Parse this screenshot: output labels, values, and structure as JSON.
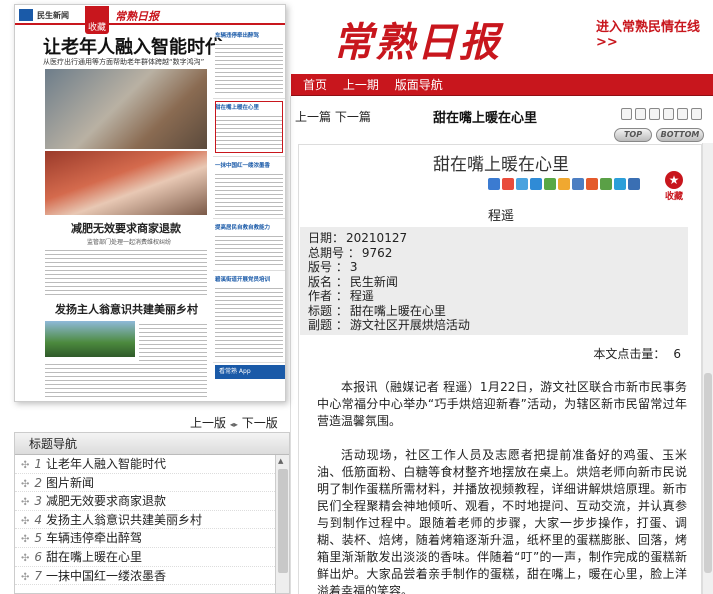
{
  "header": {
    "logo_text": "常熟日报",
    "enter_link": "进入常熟民情在线 >>"
  },
  "nav": {
    "items": [
      "首页",
      "上一期",
      "版面导航"
    ]
  },
  "page_image": {
    "section": "民生新闻",
    "logo": "常熟日报",
    "shoucang": "收藏",
    "headline": "让老年人融入智能时代",
    "subhead": "从医疗出行通用等方面帮助老年群体跨越“数字鸿沟”",
    "headline2": "减肥无效要求商家退款",
    "subhead2": "监管部门处理一起消费维权纠纷",
    "headline3": "发扬主人翁意识共建美丽乡村",
    "right_titles": [
      "车辆违停牵出醉驾",
      "甜在嘴上暖在心里",
      "一抹中国红一缕浓墨香",
      "提高居民自救自救能力",
      "碧溪街道开展党员培训"
    ],
    "app_label": "看常熟 App"
  },
  "page_nav": {
    "prev": "上一版",
    "next": "下一版"
  },
  "toc": {
    "heading": "标题导航",
    "items": [
      {
        "num": "1",
        "title": "让老年人融入智能时代"
      },
      {
        "num": "2",
        "title": "图片新闻"
      },
      {
        "num": "3",
        "title": "减肥无效要求商家退款"
      },
      {
        "num": "4",
        "title": "发扬主人翁意识共建美丽乡村"
      },
      {
        "num": "5",
        "title": "车辆违停牵出醉驾"
      },
      {
        "num": "6",
        "title": "甜在嘴上暖在心里"
      },
      {
        "num": "7",
        "title": "一抹中国红一缕浓墨香"
      }
    ]
  },
  "article_bar": {
    "prev": "上一篇",
    "next": "下一篇",
    "title": "甜在嘴上暖在心里",
    "top": "TOP",
    "bottom": "BOTTOM"
  },
  "article": {
    "title": "甜在嘴上暖在心里",
    "shoucang": "收藏",
    "author": "程遥",
    "meta": [
      {
        "label": "日期：",
        "value": "20210127"
      },
      {
        "label": "总期号 ：",
        "value": "9762"
      },
      {
        "label": "版号 ：",
        "value": "3"
      },
      {
        "label": "版名 ：",
        "value": "民生新闻"
      },
      {
        "label": "作者 ：",
        "value": "程遥"
      },
      {
        "label": "标题 ：",
        "value": "甜在嘴上暖在心里"
      },
      {
        "label": "副题 ：",
        "value": "游文社区开展烘焙活动"
      }
    ],
    "clicks_label": "本文点击量：",
    "clicks_value": "6",
    "paragraphs": [
      "本报讯（融媒记者 程遥）1月22日，游文社区联合市新市民事务中心常福分中心举办“巧手烘焙迎新春”活动，为辖区新市民留常过年营造温馨氛围。",
      "活动现场，社区工作人员及志愿者把提前准备好的鸡蛋、玉米油、低筋面粉、白糖等食材整齐地摆放在桌上。烘焙老师向新市民说明了制作蛋糕所需材料，并播放视频教程，详细讲解烘焙原理。新市民们全程聚精会神地倾听、观看，不时地提问、互动交流，并认真参与到制作过程中。跟随着老师的步骤，大家一步步操作，打蛋、调糊、装杯、焙烤，随着烤箱逐渐升温，纸杯里的蛋糕膨胀、回落，烤箱里渐渐散发出淡淡的香味。伴随着“叮”的一声，制作完成的蛋糕新鲜出炉。大家品尝着亲手制作的蛋糕，甜在嘴上，暖在心里，脸上洋溢着幸福的笑容。"
    ]
  },
  "colors": {
    "brand_red": "#c8161d",
    "nav_text": "#ffffff"
  }
}
